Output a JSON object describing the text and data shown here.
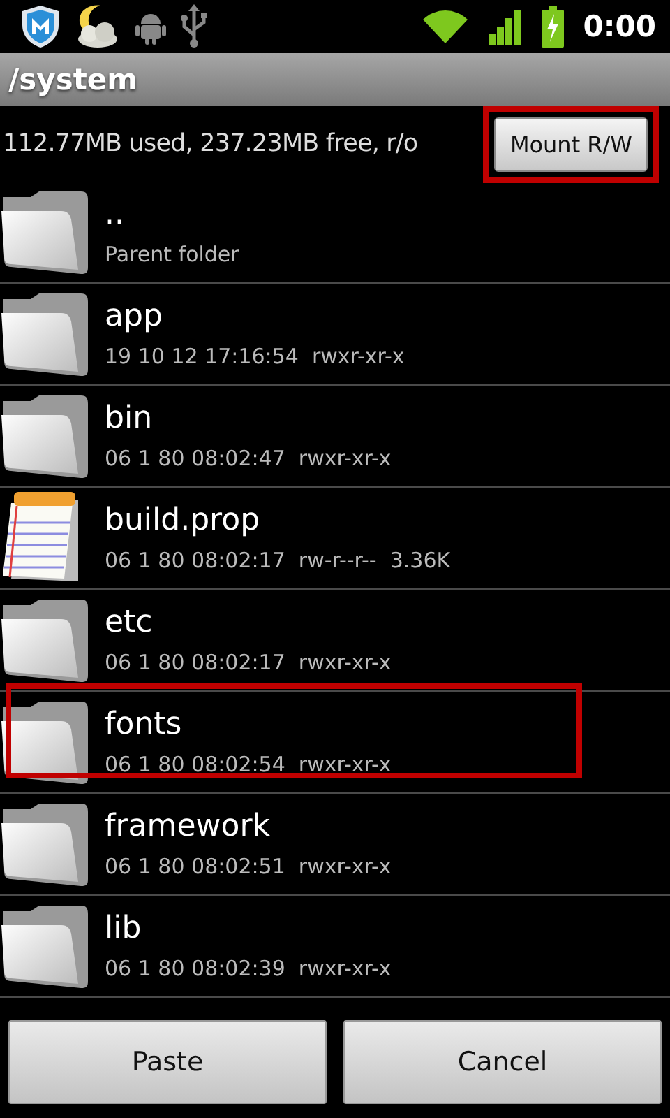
{
  "status_bar": {
    "time": "0:00"
  },
  "title": "/system",
  "storage": {
    "text": "112.77MB used, 237.23MB free, r/o",
    "button": {
      "label": "Mount R/W",
      "highlighted": true
    }
  },
  "files": [
    {
      "name": "..",
      "details": "Parent folder",
      "kind": "folder",
      "highlighted": false
    },
    {
      "name": "app",
      "details": "19 10 12 17:16:54  rwxr-xr-x",
      "kind": "folder",
      "highlighted": false
    },
    {
      "name": "bin",
      "details": "06 1 80 08:02:47  rwxr-xr-x",
      "kind": "folder",
      "highlighted": false
    },
    {
      "name": "build.prop",
      "details": "06 1 80 08:02:17  rw-r--r--  3.36K",
      "kind": "file",
      "highlighted": false
    },
    {
      "name": "etc",
      "details": "06 1 80 08:02:17  rwxr-xr-x",
      "kind": "folder",
      "highlighted": false
    },
    {
      "name": "fonts",
      "details": "06 1 80 08:02:54  rwxr-xr-x",
      "kind": "folder",
      "highlighted": true
    },
    {
      "name": "framework",
      "details": "06 1 80 08:02:51  rwxr-xr-x",
      "kind": "folder",
      "highlighted": false
    },
    {
      "name": "lib",
      "details": "06 1 80 08:02:39  rwxr-xr-x",
      "kind": "folder",
      "highlighted": false
    }
  ],
  "buttons": [
    "Paste",
    "Cancel"
  ]
}
